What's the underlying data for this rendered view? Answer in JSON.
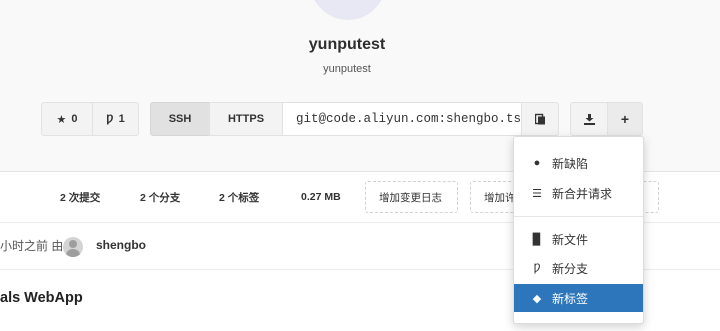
{
  "project": {
    "name": "yunputest",
    "path": "yunputest"
  },
  "toolbar": {
    "star_count": "0",
    "fork_count": "1",
    "ssh_label": "SSH",
    "https_label": "HTTPS",
    "clone_url": "git@code.aliyun.com:shengbo.tsb",
    "plus_label": "+"
  },
  "stats": {
    "commits": "2 次提交",
    "branches": "2 个分支",
    "tags": "2 个标签",
    "size": "0.27 MB",
    "changelog_button": "增加变更日志",
    "partial_button": "增加许"
  },
  "commit": {
    "time_text": "小时之前 由",
    "author": "shengbo"
  },
  "readme": {
    "title": "als WebApp"
  },
  "dropdown": {
    "items": [
      {
        "label": "新缺陷",
        "icon": "exclamation-circle-icon"
      },
      {
        "label": "新合并请求",
        "icon": "merge-request-icon"
      },
      {
        "label": "新文件",
        "icon": "file-icon"
      },
      {
        "label": "新分支",
        "icon": "branch-icon"
      },
      {
        "label": "新标签",
        "icon": "tags-icon"
      }
    ]
  },
  "colors": {
    "accent": "#2d76bb",
    "hero_bg": "#f9f9f9"
  }
}
